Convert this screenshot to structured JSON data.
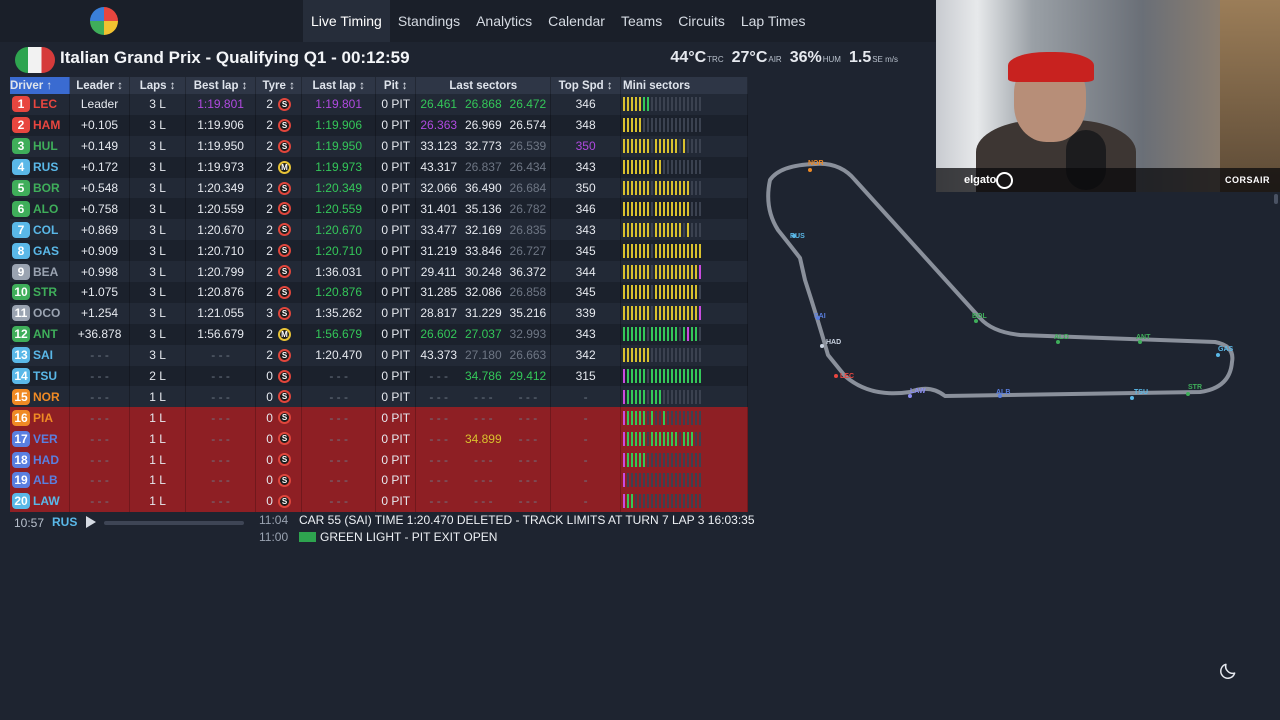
{
  "nav": {
    "items": [
      "Live Timing",
      "Standings",
      "Analytics",
      "Calendar",
      "Teams",
      "Circuits",
      "Lap Times"
    ],
    "active": "Live Timing"
  },
  "session": {
    "title": "Italian Grand Prix - Qualifying Q1 - 00:12:59",
    "weather": {
      "track_temp": "44°C",
      "track_label": "TRC",
      "air_temp": "27°C",
      "air_label": "AIR",
      "humidity": "36%",
      "humidity_label": "HUM",
      "wind": "1.5",
      "wind_label": "SE m/s"
    }
  },
  "table": {
    "headers": [
      "Driver ↑",
      "Leader ↕",
      "Laps ↕",
      "Best lap ↕",
      "Tyre ↕",
      "Last lap ↕",
      "Pit ↕",
      "Last sectors",
      "Top Spd ↕",
      "Mini sectors"
    ],
    "rows": [
      {
        "pos": "1",
        "code": "LEC",
        "color": "#e8463f",
        "leader": "Leader",
        "laps": "3 L",
        "best": "1:19.801",
        "best_cls": "purple",
        "tyre_laps": "2",
        "tyre": "S",
        "last": "1:19.801",
        "last_cls": "purple",
        "pit": "0 PIT",
        "s": [
          "26.461",
          "26.868",
          "26.472"
        ],
        "s_cls": [
          "green",
          "green",
          "green"
        ],
        "spd": "346",
        "spd_cls": "",
        "mini": "yyyyyggddddddddddddd",
        "out": false
      },
      {
        "pos": "2",
        "code": "HAM",
        "color": "#e8463f",
        "leader": "+0.105",
        "laps": "3 L",
        "best": "1:19.906",
        "best_cls": "",
        "tyre_laps": "2",
        "tyre": "S",
        "last": "1:19.906",
        "last_cls": "green",
        "pit": "0 PIT",
        "s": [
          "26.363",
          "26.969",
          "26.574"
        ],
        "s_cls": [
          "purple",
          "",
          ""
        ],
        "spd": "348",
        "spd_cls": "",
        "mini": "yyyyyddddddddddddddd",
        "out": false
      },
      {
        "pos": "3",
        "code": "HUL",
        "color": "#3fae5a",
        "leader": "+0.149",
        "laps": "3 L",
        "best": "1:19.950",
        "best_cls": "",
        "tyre_laps": "2",
        "tyre": "S",
        "last": "1:19.950",
        "last_cls": "green",
        "pit": "0 PIT",
        "s": [
          "33.123",
          "32.773",
          "26.539"
        ],
        "s_cls": [
          "",
          "",
          "dim"
        ],
        "spd": "350",
        "spd_cls": "purple",
        "mini": "yyyyyyydyyyyyydydddd",
        "out": false
      },
      {
        "pos": "4",
        "code": "RUS",
        "color": "#5ab8e8",
        "leader": "+0.172",
        "laps": "3 L",
        "best": "1:19.973",
        "best_cls": "",
        "tyre_laps": "2",
        "tyre": "M",
        "last": "1:19.973",
        "last_cls": "green",
        "pit": "0 PIT",
        "s": [
          "43.317",
          "26.837",
          "26.434"
        ],
        "s_cls": [
          "",
          "dim",
          "dim"
        ],
        "spd": "343",
        "spd_cls": "",
        "mini": "yyyyyyydyydddddddddd",
        "out": false
      },
      {
        "pos": "5",
        "code": "BOR",
        "color": "#3fae5a",
        "leader": "+0.548",
        "laps": "3 L",
        "best": "1:20.349",
        "best_cls": "",
        "tyre_laps": "2",
        "tyre": "S",
        "last": "1:20.349",
        "last_cls": "green",
        "pit": "0 PIT",
        "s": [
          "32.066",
          "36.490",
          "26.684"
        ],
        "s_cls": [
          "",
          "",
          "dim"
        ],
        "spd": "350",
        "spd_cls": "",
        "mini": "yyyyyyydyyyyyyyyyddd",
        "out": false
      },
      {
        "pos": "6",
        "code": "ALO",
        "color": "#3fae5a",
        "leader": "+0.758",
        "laps": "3 L",
        "best": "1:20.559",
        "best_cls": "",
        "tyre_laps": "2",
        "tyre": "S",
        "last": "1:20.559",
        "last_cls": "green",
        "pit": "0 PIT",
        "s": [
          "31.401",
          "35.136",
          "26.782"
        ],
        "s_cls": [
          "",
          "",
          "dim"
        ],
        "spd": "346",
        "spd_cls": "",
        "mini": "yyyyyyydyyyyyyyyyddd",
        "out": false
      },
      {
        "pos": "7",
        "code": "COL",
        "color": "#5ab8e8",
        "leader": "+0.869",
        "laps": "3 L",
        "best": "1:20.670",
        "best_cls": "",
        "tyre_laps": "2",
        "tyre": "S",
        "last": "1:20.670",
        "last_cls": "green",
        "pit": "0 PIT",
        "s": [
          "33.477",
          "32.169",
          "26.835"
        ],
        "s_cls": [
          "",
          "",
          "dim"
        ],
        "spd": "343",
        "spd_cls": "",
        "mini": "yyyyyyydyyyyyyydyddd",
        "out": false
      },
      {
        "pos": "8",
        "code": "GAS",
        "color": "#5ab8e8",
        "leader": "+0.909",
        "laps": "3 L",
        "best": "1:20.710",
        "best_cls": "",
        "tyre_laps": "2",
        "tyre": "S",
        "last": "1:20.710",
        "last_cls": "green",
        "pit": "0 PIT",
        "s": [
          "31.219",
          "33.846",
          "26.727"
        ],
        "s_cls": [
          "",
          "",
          "dim"
        ],
        "spd": "345",
        "spd_cls": "",
        "mini": "yyyyyyydyyyyyyyyyyyy",
        "out": false
      },
      {
        "pos": "9",
        "code": "BEA",
        "color": "#9aa3b1",
        "leader": "+0.998",
        "laps": "3 L",
        "best": "1:20.799",
        "best_cls": "",
        "tyre_laps": "2",
        "tyre": "S",
        "last": "1:36.031",
        "last_cls": "",
        "pit": "0 PIT",
        "s": [
          "29.411",
          "30.248",
          "36.372"
        ],
        "s_cls": [
          "",
          "",
          ""
        ],
        "spd": "344",
        "spd_cls": "",
        "mini": "yyyyyyydyyyyyyyyyyyp",
        "out": false
      },
      {
        "pos": "10",
        "code": "STR",
        "color": "#3fae5a",
        "leader": "+1.075",
        "laps": "3 L",
        "best": "1:20.876",
        "best_cls": "",
        "tyre_laps": "2",
        "tyre": "S",
        "last": "1:20.876",
        "last_cls": "green",
        "pit": "0 PIT",
        "s": [
          "31.285",
          "32.086",
          "26.858"
        ],
        "s_cls": [
          "",
          "",
          "dim"
        ],
        "spd": "345",
        "spd_cls": "",
        "mini": "yyyyyyydyyyyyyyyyyyd",
        "out": false
      },
      {
        "pos": "11",
        "code": "OCO",
        "color": "#9aa3b1",
        "leader": "+1.254",
        "laps": "3 L",
        "best": "1:21.055",
        "best_cls": "",
        "tyre_laps": "3",
        "tyre": "S",
        "last": "1:35.262",
        "last_cls": "",
        "pit": "0 PIT",
        "s": [
          "28.817",
          "31.229",
          "35.216"
        ],
        "s_cls": [
          "",
          "",
          ""
        ],
        "spd": "339",
        "spd_cls": "",
        "mini": "yyyyyyydyyyyyyyyyyyp",
        "out": false
      },
      {
        "pos": "12",
        "code": "ANT",
        "color": "#3fae5a",
        "leader": "+36.878",
        "laps": "3 L",
        "best": "1:56.679",
        "best_cls": "",
        "tyre_laps": "2",
        "tyre": "M",
        "last": "1:56.679",
        "last_cls": "green",
        "pit": "0 PIT",
        "s": [
          "26.602",
          "27.037",
          "32.993"
        ],
        "s_cls": [
          "green",
          "green",
          "dim"
        ],
        "spd": "343",
        "spd_cls": "",
        "mini": "ggggggdgggggggdgpggd",
        "out": false
      },
      {
        "pos": "13",
        "code": "SAI",
        "color": "#5ab8e8",
        "leader": "- - -",
        "laps": "3 L",
        "best": "- - -",
        "best_cls": "dim",
        "tyre_laps": "2",
        "tyre": "S",
        "last": "1:20.470",
        "last_cls": "",
        "pit": "0 PIT",
        "s": [
          "43.373",
          "27.180",
          "26.663"
        ],
        "s_cls": [
          "",
          "dim",
          "dim"
        ],
        "spd": "342",
        "spd_cls": "",
        "mini": "yyyyyyyddddddddddddd",
        "out": false
      },
      {
        "pos": "14",
        "code": "TSU",
        "color": "#5ab8e8",
        "leader": "- - -",
        "laps": "2 L",
        "best": "- - -",
        "best_cls": "dim",
        "tyre_laps": "0",
        "tyre": "S",
        "last": "- - -",
        "last_cls": "dim",
        "pit": "0 PIT",
        "s": [
          "- - -",
          "34.786",
          "29.412"
        ],
        "s_cls": [
          "dim",
          "green",
          "green"
        ],
        "spd": "315",
        "spd_cls": "",
        "mini": "pgggggdggggggggggggg",
        "out": false
      },
      {
        "pos": "15",
        "code": "NOR",
        "color": "#f08a24",
        "leader": "- - -",
        "laps": "1 L",
        "best": "- - -",
        "best_cls": "dim",
        "tyre_laps": "0",
        "tyre": "S",
        "last": "- - -",
        "last_cls": "dim",
        "pit": "0 PIT",
        "s": [
          "- - -",
          "- - -",
          "- - -"
        ],
        "s_cls": [
          "dim",
          "dim",
          "dim"
        ],
        "spd": "-",
        "spd_cls": "dim",
        "mini": "pgggggdgggdddddddddd",
        "out": false
      },
      {
        "pos": "16",
        "code": "PIA",
        "color": "#f08a24",
        "leader": "- - -",
        "laps": "1 L",
        "best": "- - -",
        "best_cls": "dim",
        "tyre_laps": "0",
        "tyre": "S",
        "last": "- - -",
        "last_cls": "dim",
        "pit": "0 PIT",
        "s": [
          "- - -",
          "- - -",
          "- - -"
        ],
        "s_cls": [
          "dim",
          "dim",
          "dim"
        ],
        "spd": "-",
        "spd_cls": "dim",
        "mini": "pgggggdgddgddddddddd",
        "out": true
      },
      {
        "pos": "17",
        "code": "VER",
        "color": "#5a7fe0",
        "leader": "- - -",
        "laps": "1 L",
        "best": "- - -",
        "best_cls": "dim",
        "tyre_laps": "0",
        "tyre": "S",
        "last": "- - -",
        "last_cls": "dim",
        "pit": "0 PIT",
        "s": [
          "- - -",
          "34.899",
          "- - -"
        ],
        "s_cls": [
          "dim",
          "yellow",
          "dim"
        ],
        "spd": "-",
        "spd_cls": "dim",
        "mini": "pgggggdgggggggdgggdd",
        "out": true
      },
      {
        "pos": "18",
        "code": "HAD",
        "color": "#5a7fe0",
        "leader": "- - -",
        "laps": "1 L",
        "best": "- - -",
        "best_cls": "dim",
        "tyre_laps": "0",
        "tyre": "S",
        "last": "- - -",
        "last_cls": "dim",
        "pit": "0 PIT",
        "s": [
          "- - -",
          "- - -",
          "- - -"
        ],
        "s_cls": [
          "dim",
          "dim",
          "dim"
        ],
        "spd": "-",
        "spd_cls": "dim",
        "mini": "pgggggdddddddddddddd",
        "out": true
      },
      {
        "pos": "19",
        "code": "ALB",
        "color": "#5a7fe0",
        "leader": "- - -",
        "laps": "1 L",
        "best": "- - -",
        "best_cls": "dim",
        "tyre_laps": "0",
        "tyre": "S",
        "last": "- - -",
        "last_cls": "dim",
        "pit": "0 PIT",
        "s": [
          "- - -",
          "- - -",
          "- - -"
        ],
        "s_cls": [
          "dim",
          "dim",
          "dim"
        ],
        "spd": "-",
        "spd_cls": "dim",
        "mini": "pddddddddddddddddddd",
        "out": true
      },
      {
        "pos": "20",
        "code": "LAW",
        "color": "#5ab8e8",
        "leader": "- - -",
        "laps": "1 L",
        "best": "- - -",
        "best_cls": "dim",
        "tyre_laps": "0",
        "tyre": "S",
        "last": "- - -",
        "last_cls": "dim",
        "pit": "0 PIT",
        "s": [
          "- - -",
          "- - -",
          "- - -"
        ],
        "s_cls": [
          "dim",
          "dim",
          "dim"
        ],
        "spd": "-",
        "spd_cls": "dim",
        "mini": "pggddddddddddddddddd",
        "out": true
      }
    ]
  },
  "footer": {
    "time": "10:57",
    "driver": "RUS",
    "messages": [
      {
        "time": "11:04",
        "text": "CAR 55 (SAI) TIME 1:20.470 DELETED - TRACK LIMITS AT TURN 7 LAP 3 16:03:35",
        "flag": false
      },
      {
        "time": "11:00",
        "text": "GREEN LIGHT - PIT EXIT OPEN",
        "flag": true
      }
    ]
  },
  "webcam": {
    "brand_left": "elgato",
    "brand_right": "CORSAIR"
  },
  "map": {
    "labels": [
      {
        "text": "NOR",
        "color": "#f08a24"
      },
      {
        "text": "RUS",
        "color": "#5ab8e8"
      },
      {
        "text": "SAI",
        "color": "#5a7fe0"
      },
      {
        "text": "HAD",
        "color": "#c9d2e0"
      },
      {
        "text": "LEC",
        "color": "#e8463f"
      },
      {
        "text": "BOL",
        "color": "#3fae5a"
      },
      {
        "text": "ALO",
        "color": "#3fae5a"
      },
      {
        "text": "ANT",
        "color": "#3fae5a"
      },
      {
        "text": "LAW",
        "color": "#8a8cf0"
      },
      {
        "text": "ALB",
        "color": "#5a7fe0"
      },
      {
        "text": "TSU",
        "color": "#5ab8e8"
      },
      {
        "text": "GAS",
        "color": "#5ab8e8"
      },
      {
        "text": "STR",
        "color": "#3fae5a"
      }
    ]
  },
  "colors": {
    "purple": "#b04ae0",
    "green": "#34c759",
    "yellow": "#d9c12e",
    "out_row": "#8e1f24"
  }
}
